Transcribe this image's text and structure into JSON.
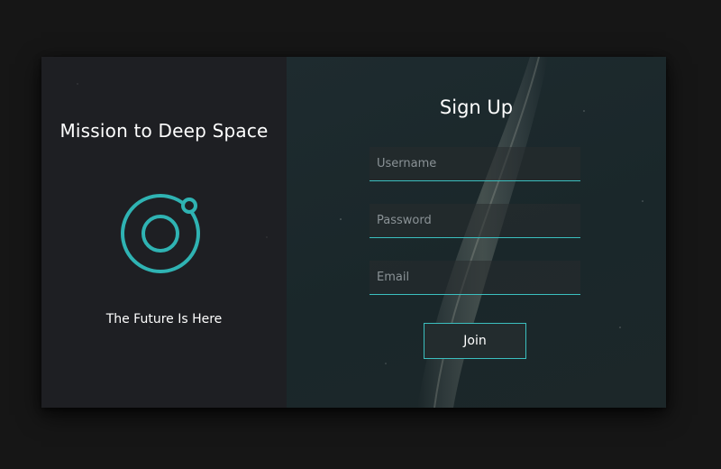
{
  "brand": {
    "title": "Mission to Deep Space",
    "tagline": "The Future Is Here",
    "logo_icon": "orbit-ring-icon",
    "accent_color": "#2fb3b3"
  },
  "signup": {
    "title": "Sign Up",
    "username_placeholder": "Username",
    "password_placeholder": "Password",
    "email_placeholder": "Email",
    "username_value": "",
    "password_value": "",
    "email_value": "",
    "join_label": "Join"
  },
  "colors": {
    "page_background": "#161616",
    "left_panel": "#1e1f23",
    "right_panel": "#1d2a2d",
    "field_underline": "#3bbfbf"
  }
}
